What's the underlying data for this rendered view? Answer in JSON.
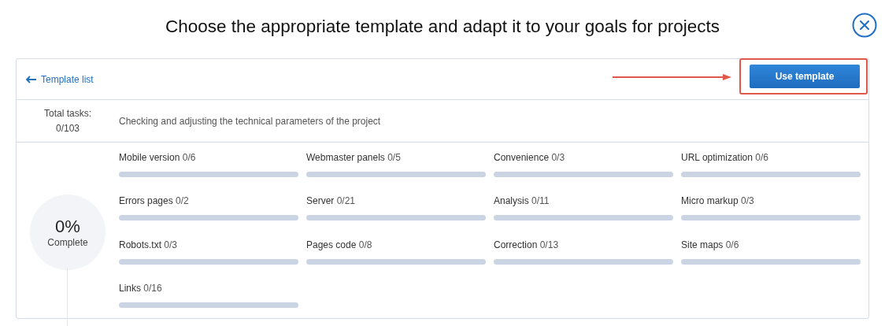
{
  "title": "Choose the appropriate template and adapt it to your goals for projects",
  "back_link": {
    "label": "Template list"
  },
  "primary_button": {
    "label": "Use template"
  },
  "summary": {
    "total_label": "Total tasks:",
    "total_value": "0/103",
    "description": "Checking and adjusting the technical parameters of the project"
  },
  "progress": {
    "percent": "0%",
    "label": "Complete"
  },
  "categories": [
    {
      "name": "Mobile version",
      "count": "0/6"
    },
    {
      "name": "Webmaster panels",
      "count": "0/5"
    },
    {
      "name": "Convenience",
      "count": "0/3"
    },
    {
      "name": "URL optimization",
      "count": "0/6"
    },
    {
      "name": "Errors pages",
      "count": "0/2"
    },
    {
      "name": "Server",
      "count": "0/21"
    },
    {
      "name": "Analysis",
      "count": "0/11"
    },
    {
      "name": "Micro markup",
      "count": "0/3"
    },
    {
      "name": "Robots.txt",
      "count": "0/3"
    },
    {
      "name": "Pages code",
      "count": "0/8"
    },
    {
      "name": "Correction",
      "count": "0/13"
    },
    {
      "name": "Site maps",
      "count": "0/6"
    },
    {
      "name": "Links",
      "count": "0/16"
    }
  ]
}
